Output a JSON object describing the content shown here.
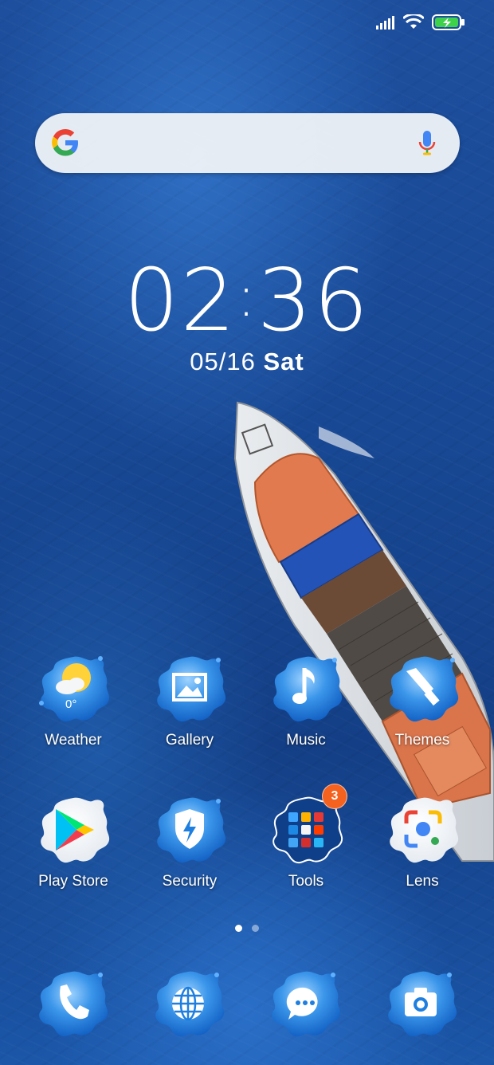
{
  "status_bar": {
    "signal": "signal-icon",
    "wifi": "wifi-icon",
    "battery": "battery-charging-icon"
  },
  "search": {
    "logo": "google-g-icon",
    "mic": "mic-icon"
  },
  "clock": {
    "hours": "02",
    "separator": ":",
    "minutes": "36"
  },
  "date": {
    "date": "05/16",
    "day": "Sat"
  },
  "weather": {
    "temp": "0°"
  },
  "home_apps": [
    {
      "label": "Weather",
      "icon": "weather-icon"
    },
    {
      "label": "Gallery",
      "icon": "gallery-icon"
    },
    {
      "label": "Music",
      "icon": "music-icon"
    },
    {
      "label": "Themes",
      "icon": "themes-icon"
    },
    {
      "label": "Play Store",
      "icon": "play-store-icon"
    },
    {
      "label": "Security",
      "icon": "security-icon"
    },
    {
      "label": "Tools",
      "icon": "tools-folder-icon",
      "badge": "3"
    },
    {
      "label": "Lens",
      "icon": "lens-icon"
    }
  ],
  "page_indicator": {
    "count": 2,
    "active": 1
  },
  "dock": [
    {
      "icon": "phone-icon"
    },
    {
      "icon": "browser-icon"
    },
    {
      "icon": "messages-icon"
    },
    {
      "icon": "camera-icon"
    }
  ],
  "colors": {
    "splash_blue": "#1e7fe0",
    "splash_light": "#7cc3ff",
    "badge": "#f5611e"
  }
}
